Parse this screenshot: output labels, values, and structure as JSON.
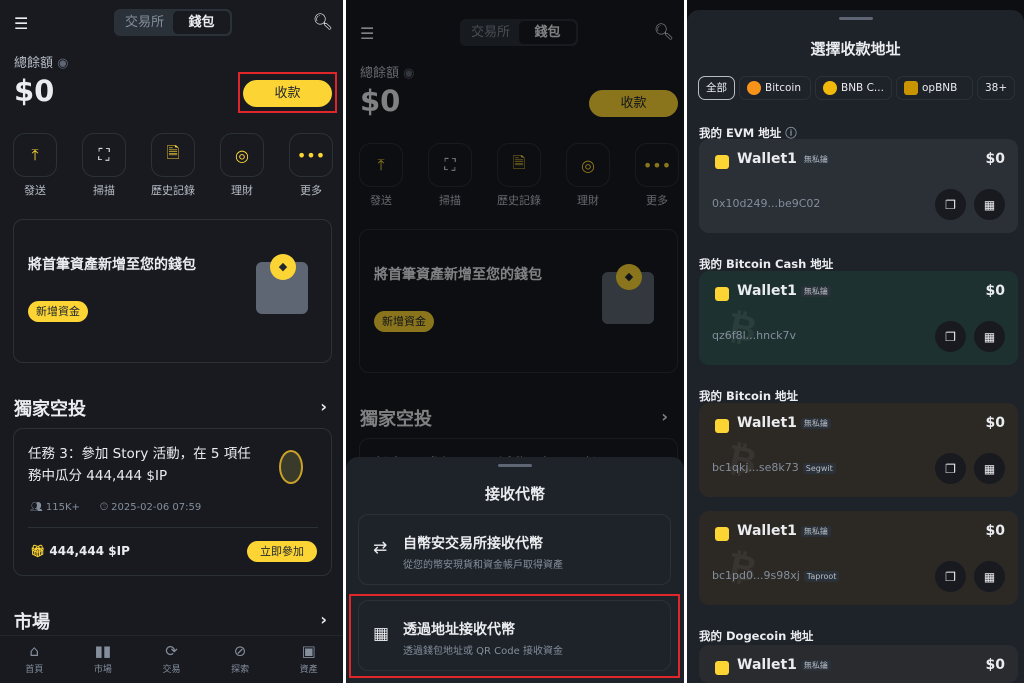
{
  "home": {
    "tabs": [
      "交易所",
      "錢包"
    ],
    "balance_label": "總餘額",
    "balance": "$0",
    "receive_button": "收款",
    "actions": [
      {
        "label": "發送",
        "icon": "send-icon"
      },
      {
        "label": "掃描",
        "icon": "scan-icon"
      },
      {
        "label": "歷史記錄",
        "icon": "history-icon"
      },
      {
        "label": "理財",
        "icon": "earn-icon"
      },
      {
        "label": "更多",
        "icon": "more-icon"
      }
    ],
    "promo": {
      "title": "將首筆資產新增至您的錢包",
      "button": "新增資金"
    },
    "airdrop": {
      "heading": "獨家空投",
      "task": "任務 3：參加 Story 活動，在 5 項任務中瓜分 444,444 $IP",
      "participants": "115K+",
      "time": "2025-02-06 07:59",
      "reward": "444,444 $IP",
      "join": "立即參加"
    },
    "market_heading": "市場",
    "nav": [
      "首頁",
      "市場",
      "交易",
      "探索",
      "資產"
    ]
  },
  "receive_sheet": {
    "title": "接收代幣",
    "options": [
      {
        "title": "自幣安交易所接收代幣",
        "subtitle": "從您的幣安現貨和資金帳戶取得資產"
      },
      {
        "title": "透過地址接收代幣",
        "subtitle": "透過錢包地址或 QR Code 接收資金"
      }
    ]
  },
  "address_sheet": {
    "title": "選擇收款地址",
    "chips": [
      "全部",
      "Bitcoin",
      "BNB C...",
      "opBNB",
      "38+"
    ],
    "sections": [
      {
        "label": "我的 EVM 地址",
        "cards": [
          {
            "name": "Wallet1",
            "tag": "無私鑰",
            "value": "$0",
            "address": "0x10d249...be9C02",
            "type": ""
          }
        ]
      },
      {
        "label": "我的 Bitcoin Cash 地址",
        "cards": [
          {
            "name": "Wallet1",
            "tag": "無私鑰",
            "value": "$0",
            "address": "qz6f8l...hnck7v",
            "type": ""
          }
        ]
      },
      {
        "label": "我的 Bitcoin 地址",
        "cards": [
          {
            "name": "Wallet1",
            "tag": "無私鑰",
            "value": "$0",
            "address": "bc1qkj...se8k73",
            "type": "Segwit"
          },
          {
            "name": "Wallet1",
            "tag": "無私鑰",
            "value": "$0",
            "address": "bc1pd0...9s98xj",
            "type": "Taproot"
          }
        ]
      },
      {
        "label": "我的 Dogecoin 地址",
        "cards": [
          {
            "name": "Wallet1",
            "tag": "無私鑰",
            "value": "$0",
            "address": "",
            "type": ""
          }
        ]
      }
    ]
  },
  "colors": {
    "accent": "#fcd535",
    "bg": "#181a20",
    "highlight": "#e0262a"
  }
}
